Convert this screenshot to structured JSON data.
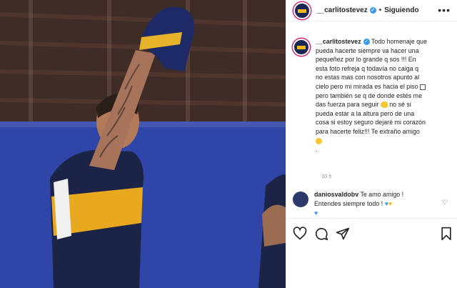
{
  "post": {
    "username": "__carlitostevez",
    "follow_status": "Siguiendo",
    "more_icon": "ellipsis-icon",
    "caption_user": "__carlitostevez",
    "caption_lines": [
      "Todo homenaje que",
      "pueda hacerte siempre va hacer una",
      "pequeñez por lo grande q sos !!! En",
      "esta foto refreja q todavía no caiga q",
      "no estas mas con nosotros apunto al",
      "cielo pero mi mirada es hacia el piso",
      "pero también se q de donde estés me",
      "das fuerza para seguir",
      "no sé si",
      "pueda estar a la altura pero de una",
      "cosa si estoy seguro dejaré mi corazón",
      "para hacerte feliz!!! Te extraño amigo",
      "."
    ],
    "time_ago": "10 h"
  },
  "comment": {
    "username": "daniosvaldobv",
    "text_line1": "Te amo amigo !",
    "text_line2": "Entendes siempre todo !",
    "hearts": [
      "💙",
      "💛"
    ],
    "extra_heart": "💙"
  },
  "colors": {
    "verified": "#3897f0",
    "boca_blue": "#1a2754",
    "boca_gold": "#f4b81a",
    "story_ring": "#d62976"
  }
}
